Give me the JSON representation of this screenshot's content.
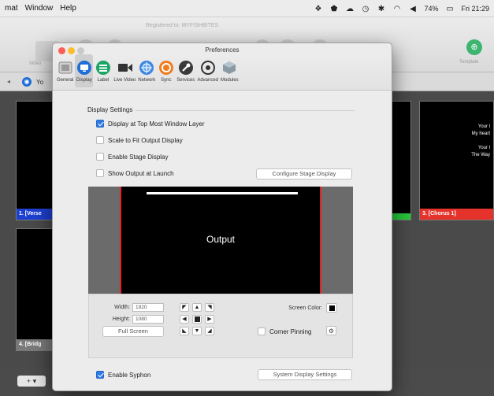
{
  "menubar": {
    "items": [
      "mat",
      "Window",
      "Help"
    ],
    "battery": "74%",
    "clock": "Fri 21:29"
  },
  "app": {
    "registered": "Registered to: MYFISHBITES",
    "toolbar_left_label": "Video",
    "toolbar_right_label": "Template",
    "library_label": "Yo",
    "slides": [
      {
        "label": "1. [Verse",
        "color": "#1d3fd0"
      },
      {
        "label": "3. [Chorus 1]",
        "color": "#e5322a",
        "text": [
          "Your l",
          "My heart",
          "",
          "Your l",
          "The Way"
        ]
      },
      {
        "label": "4. [Bridg",
        "color": "#7a7a7a"
      }
    ],
    "add_button": "+ ▾"
  },
  "prefs": {
    "title": "Preferences",
    "tabs": [
      {
        "label": "General",
        "icon": "general-icon"
      },
      {
        "label": "Display",
        "icon": "display-icon",
        "selected": true
      },
      {
        "label": "Label",
        "icon": "label-icon"
      },
      {
        "label": "Live Video",
        "icon": "video-camera-icon"
      },
      {
        "label": "Network",
        "icon": "network-icon"
      },
      {
        "label": "Sync",
        "icon": "sync-icon"
      },
      {
        "label": "Services",
        "icon": "services-icon"
      },
      {
        "label": "Advanced",
        "icon": "advanced-icon"
      },
      {
        "label": "Modules",
        "icon": "modules-icon"
      }
    ],
    "section_title": "Display Settings",
    "options": [
      {
        "label": "Display at Top Most Window Layer",
        "checked": true
      },
      {
        "label": "Scale to Fit Output Display",
        "checked": false
      },
      {
        "label": "Enable Stage Display",
        "checked": false
      },
      {
        "label": "Show Output at Launch",
        "checked": false
      }
    ],
    "configure_stage_button": "Configure Stage Display",
    "output_label": "Output",
    "width_label": "Width:",
    "width_value": "1920",
    "height_label": "Height:",
    "height_value": "1080",
    "full_screen_button": "Full Screen",
    "screen_color_label": "Screen Color:",
    "corner_pinning_label": "Corner Pinning",
    "enable_syphon_label": "Enable Syphon",
    "enable_syphon_checked": true,
    "system_display_button": "System Display Settings"
  }
}
